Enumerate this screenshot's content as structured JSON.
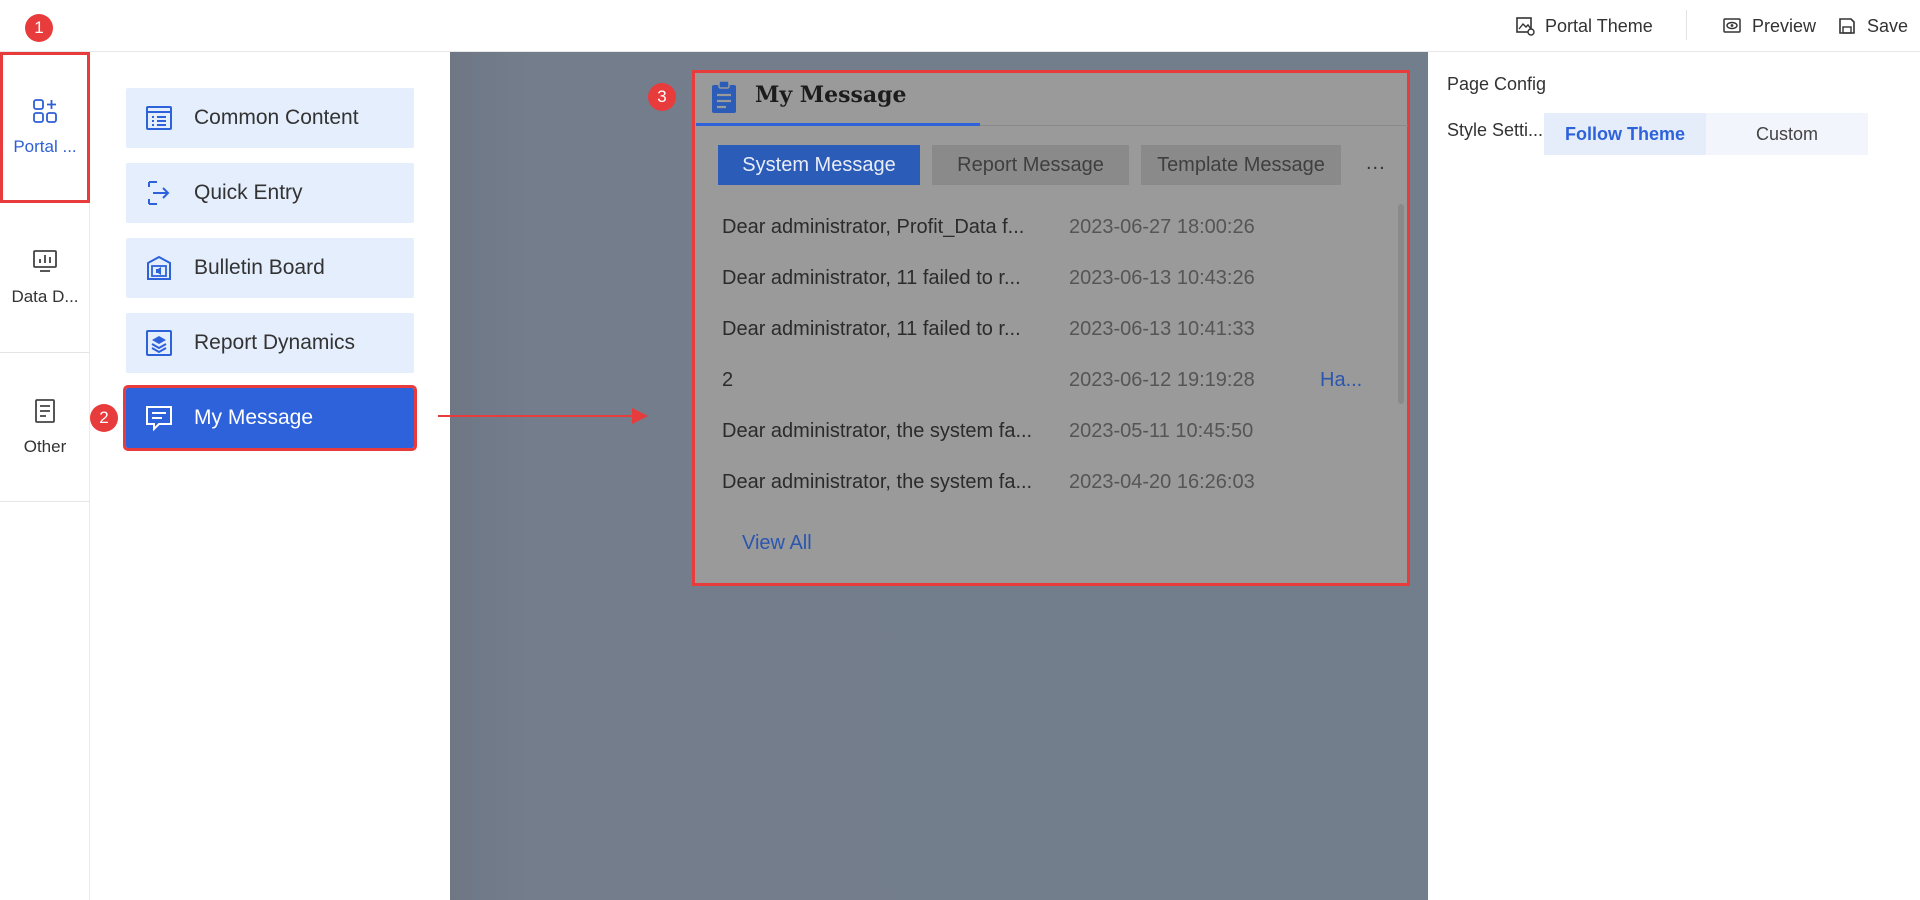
{
  "topbar": {
    "portal_theme": "Portal Theme",
    "preview": "Preview",
    "save": "Save"
  },
  "rail": {
    "items": [
      {
        "label": "Portal ...",
        "icon": "grid-plus-icon",
        "active": true
      },
      {
        "label": "Data D...",
        "icon": "chart-board-icon",
        "active": false
      },
      {
        "label": "Other",
        "icon": "document-icon",
        "active": false
      }
    ]
  },
  "components": [
    {
      "label": "Common Content",
      "icon": "list-icon"
    },
    {
      "label": "Quick Entry",
      "icon": "entry-icon"
    },
    {
      "label": "Bulletin Board",
      "icon": "bulletin-icon"
    },
    {
      "label": "Report Dynamics",
      "icon": "layers-icon"
    },
    {
      "label": "My Message",
      "icon": "message-icon",
      "selected": true
    }
  ],
  "badges": {
    "one": "1",
    "two": "2",
    "three": "3"
  },
  "card": {
    "title": "My Message",
    "tabs": [
      {
        "label": "System Message",
        "active": true
      },
      {
        "label": "Report Message",
        "active": false
      },
      {
        "label": "Template Message",
        "active": false
      }
    ],
    "more": "...",
    "messages": [
      {
        "text": "Dear administrator, Profit_Data f...",
        "date": "2023-06-27 18:00:26",
        "extra": ""
      },
      {
        "text": "Dear administrator, 11 failed to r...",
        "date": "2023-06-13 10:43:26",
        "extra": ""
      },
      {
        "text": "Dear administrator, 11 failed to r...",
        "date": "2023-06-13 10:41:33",
        "extra": ""
      },
      {
        "text": "2",
        "date": "2023-06-12 19:19:28",
        "extra": "Ha..."
      },
      {
        "text": "Dear administrator, the system fa...",
        "date": "2023-05-11 10:45:50",
        "extra": ""
      },
      {
        "text": "Dear administrator, the system fa...",
        "date": "2023-04-20 16:26:03",
        "extra": ""
      }
    ],
    "view_all": "View All"
  },
  "config": {
    "title": "Page Config",
    "style_label": "Style Setti...",
    "options": [
      {
        "label": "Follow Theme",
        "active": true
      },
      {
        "label": "Custom",
        "active": false
      }
    ]
  },
  "colors": {
    "accent": "#2e62db",
    "highlight": "#e83b3b",
    "component_bg": "#e5eefc"
  }
}
